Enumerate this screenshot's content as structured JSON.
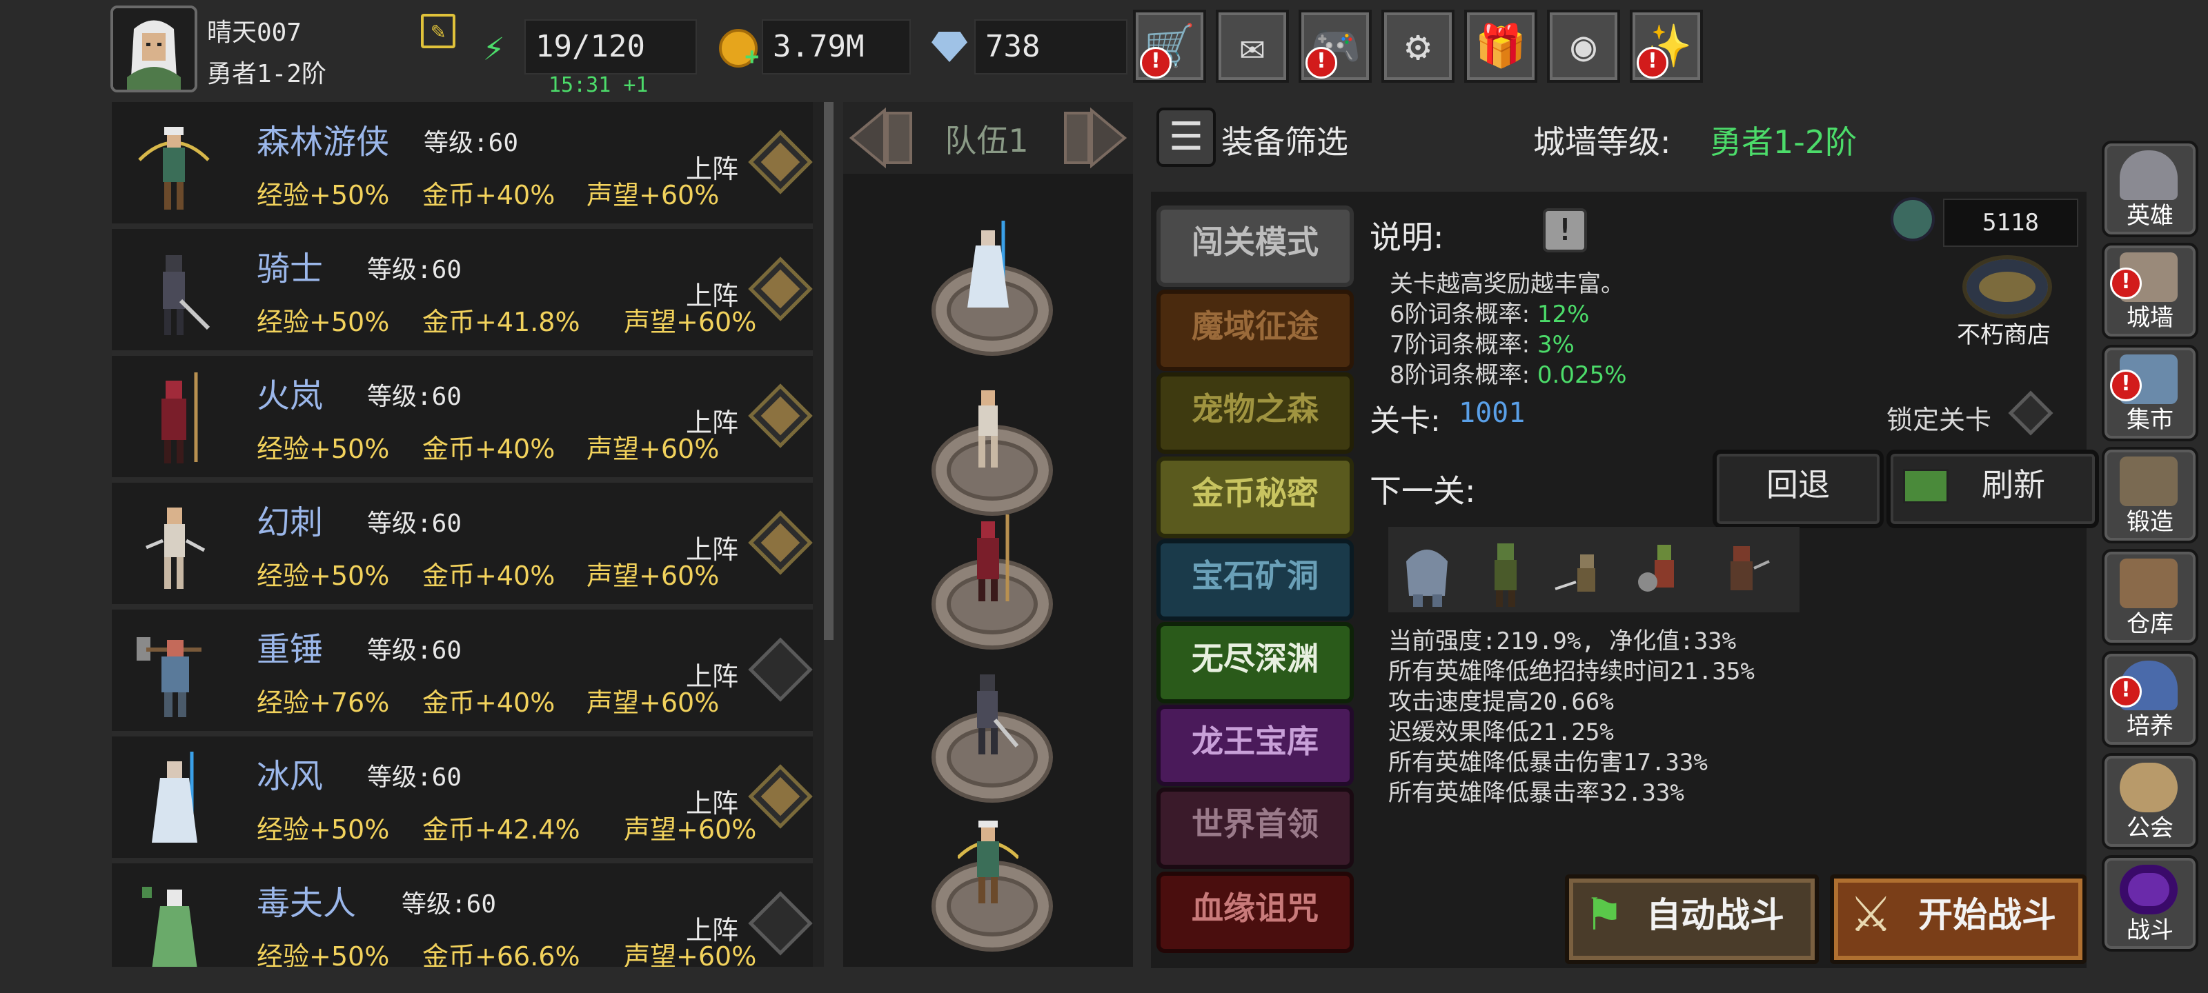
{
  "player": {
    "name": "晴天007",
    "rank": "勇者1-2阶"
  },
  "resources": {
    "energy": "19/120",
    "energy_timer": "15:31 +1",
    "gold": "3.79M",
    "gems": "738"
  },
  "heroes": [
    {
      "name": "森林游侠",
      "level": "等级:60",
      "exp": "经验+50%",
      "gold": "金币+40%",
      "fame": "声望+60%",
      "deploy": "上阵",
      "deployed": true
    },
    {
      "name": "骑士",
      "level": "等级:60",
      "exp": "经验+50%",
      "gold": "金币+41.8%",
      "fame": "声望+60%",
      "deploy": "上阵",
      "deployed": true
    },
    {
      "name": "火岚",
      "level": "等级:60",
      "exp": "经验+50%",
      "gold": "金币+40%",
      "fame": "声望+60%",
      "deploy": "上阵",
      "deployed": true
    },
    {
      "name": "幻刺",
      "level": "等级:60",
      "exp": "经验+50%",
      "gold": "金币+40%",
      "fame": "声望+60%",
      "deploy": "上阵",
      "deployed": true
    },
    {
      "name": "重锤",
      "level": "等级:60",
      "exp": "经验+76%",
      "gold": "金币+40%",
      "fame": "声望+60%",
      "deploy": "上阵",
      "deployed": false
    },
    {
      "name": "冰风",
      "level": "等级:60",
      "exp": "经验+50%",
      "gold": "金币+42.4%",
      "fame": "声望+60%",
      "deploy": "上阵",
      "deployed": true
    },
    {
      "name": "毒夫人",
      "level": "等级:60",
      "exp": "经验+50%",
      "gold": "金币+66.6%",
      "fame": "声望+60%",
      "deploy": "上阵",
      "deployed": false
    }
  ],
  "team": {
    "title": "队伍1"
  },
  "filter": {
    "label": "装备筛选"
  },
  "wall": {
    "label": "城墙等级:",
    "value": "勇者1-2阶"
  },
  "modes": [
    "闯关模式",
    "魔域征途",
    "宠物之森",
    "金币秘密",
    "宝石矿洞",
    "无尽深渊",
    "龙王宝库",
    "世界首领",
    "血缘诅咒"
  ],
  "description": {
    "label": "说明:",
    "intro": "关卡越高奖励越丰富。",
    "rates": [
      {
        "label": "6阶词条概率:",
        "value": "12%"
      },
      {
        "label": "7阶词条概率:",
        "value": "3%"
      },
      {
        "label": "8阶词条概率:",
        "value": "0.025%"
      }
    ]
  },
  "currency": {
    "value": "5118"
  },
  "shop": {
    "label": "不朽商店"
  },
  "stage": {
    "label": "关卡:",
    "value": "1001",
    "lock_label": "锁定关卡"
  },
  "next": {
    "label": "下一关:",
    "back": "回退",
    "refresh": "刷新"
  },
  "effects": [
    "当前强度:219.9%, 净化值:33%",
    "所有英雄降低绝招持续时间21.35%",
    "攻击速度提高20.66%",
    "迟缓效果降低21.25%",
    "所有英雄降低暴击伤害17.33%",
    "所有英雄降低暴击率32.33%"
  ],
  "battle": {
    "auto": "自动战斗",
    "start": "开始战斗"
  },
  "nav": [
    "英雄",
    "城墙",
    "集市",
    "锻造",
    "仓库",
    "培养",
    "公会",
    "战斗"
  ]
}
